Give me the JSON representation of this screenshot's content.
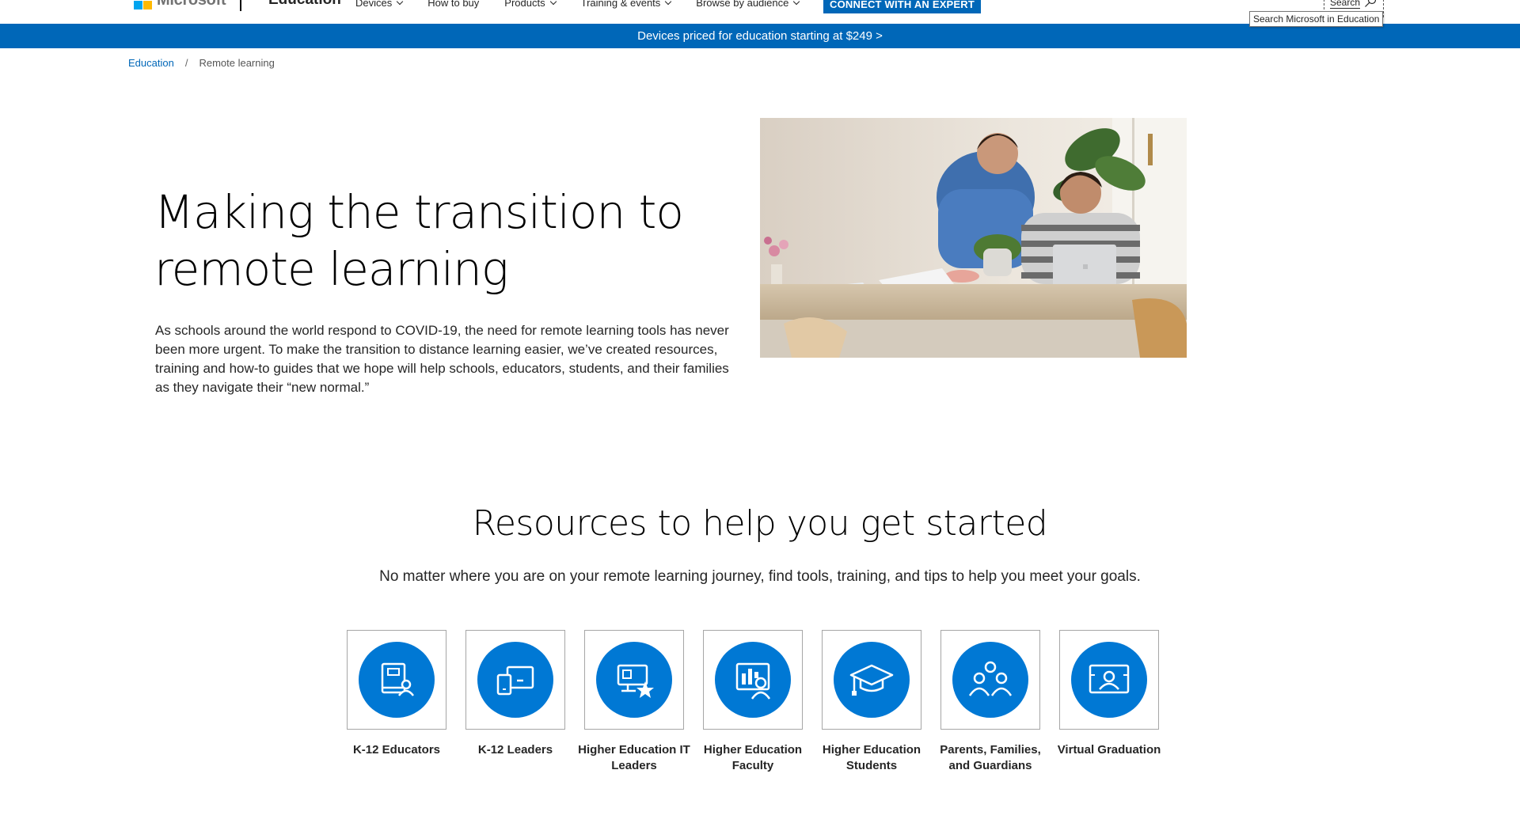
{
  "header": {
    "brand": "Microsoft",
    "site_title": "Education",
    "nav": [
      {
        "label": "Devices",
        "has_dropdown": true
      },
      {
        "label": "How to buy",
        "has_dropdown": false
      },
      {
        "label": "Products",
        "has_dropdown": true
      },
      {
        "label": "Training & events",
        "has_dropdown": true
      },
      {
        "label": "Browse by audience",
        "has_dropdown": true
      }
    ],
    "cta_label": "CONNECT WITH AN EXPERT",
    "search_label": "Search",
    "search_tooltip": "Search Microsoft in Education",
    "logo_colors": [
      "#f25022",
      "#7fba00",
      "#00a4ef",
      "#ffb900"
    ]
  },
  "banner": {
    "text": "Devices priced for education starting at $249 >",
    "color": "#0067b8"
  },
  "breadcrumb": {
    "link": "Education",
    "separator": "/",
    "current": "Remote learning"
  },
  "hero": {
    "title": "Making the transition to remote learning",
    "body": "As schools around the world respond to COVID-19, the need for remote learning tools has never been more urgent. To make the transition to distance learning easier, we’ve created resources, training and how-to guides that we hope will help schools, educators, students, and their families as they navigate their “new normal.”"
  },
  "resources": {
    "title": "Resources to help you get started",
    "subtitle": "No matter where you are on your remote learning journey, find tools, training, and tips to help you meet your goals.",
    "accent": "#0078d4",
    "cards": [
      {
        "label": "K-12 Educators",
        "icon": "educator-book-icon"
      },
      {
        "label": "K-12 Leaders",
        "icon": "devices-icon"
      },
      {
        "label": "Higher Education IT Leaders",
        "icon": "it-leader-device-star-icon"
      },
      {
        "label": "Higher Education Faculty",
        "icon": "faculty-presenter-icon"
      },
      {
        "label": "Higher Education Students",
        "icon": "graduation-cap-icon"
      },
      {
        "label": "Parents, Families, and Guardians",
        "icon": "family-group-icon"
      },
      {
        "label": "Virtual Graduation",
        "icon": "virtual-graduation-icon"
      }
    ]
  }
}
